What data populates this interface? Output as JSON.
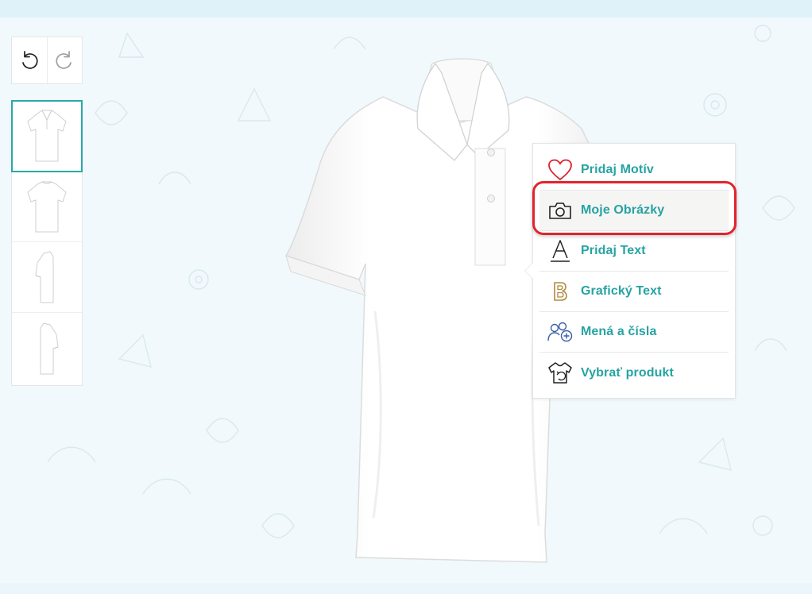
{
  "history": {
    "undo_icon": "undo-icon",
    "redo_icon": "redo-icon"
  },
  "views": [
    {
      "name": "front-view",
      "active": true
    },
    {
      "name": "back-view",
      "active": false
    },
    {
      "name": "right-side-view",
      "active": false
    },
    {
      "name": "left-side-view",
      "active": false
    }
  ],
  "product": {
    "icon": "polo-shirt-image",
    "color": "#ffffff"
  },
  "tools": [
    {
      "label": "Pridaj Motív",
      "icon": "heart-icon",
      "icon_color": "#d8242b"
    },
    {
      "label": "Moje Obrázky",
      "icon": "camera-icon",
      "icon_color": "#222222",
      "highlighted": true
    },
    {
      "label": "Pridaj Text",
      "icon": "text-a-icon",
      "icon_color": "#222222"
    },
    {
      "label": "Grafický Text",
      "icon": "graphic-b-icon",
      "icon_color": "#b08a3e"
    },
    {
      "label": "Mená a čísla",
      "icon": "names-numbers-icon",
      "icon_color": "#3a5da8"
    },
    {
      "label": "Vybrať produkt",
      "icon": "tshirt-swap-icon",
      "icon_color": "#222222"
    }
  ],
  "colors": {
    "accent": "#27a3a3",
    "highlight_ring": "#e0252c",
    "background": "#f1f9fc"
  }
}
